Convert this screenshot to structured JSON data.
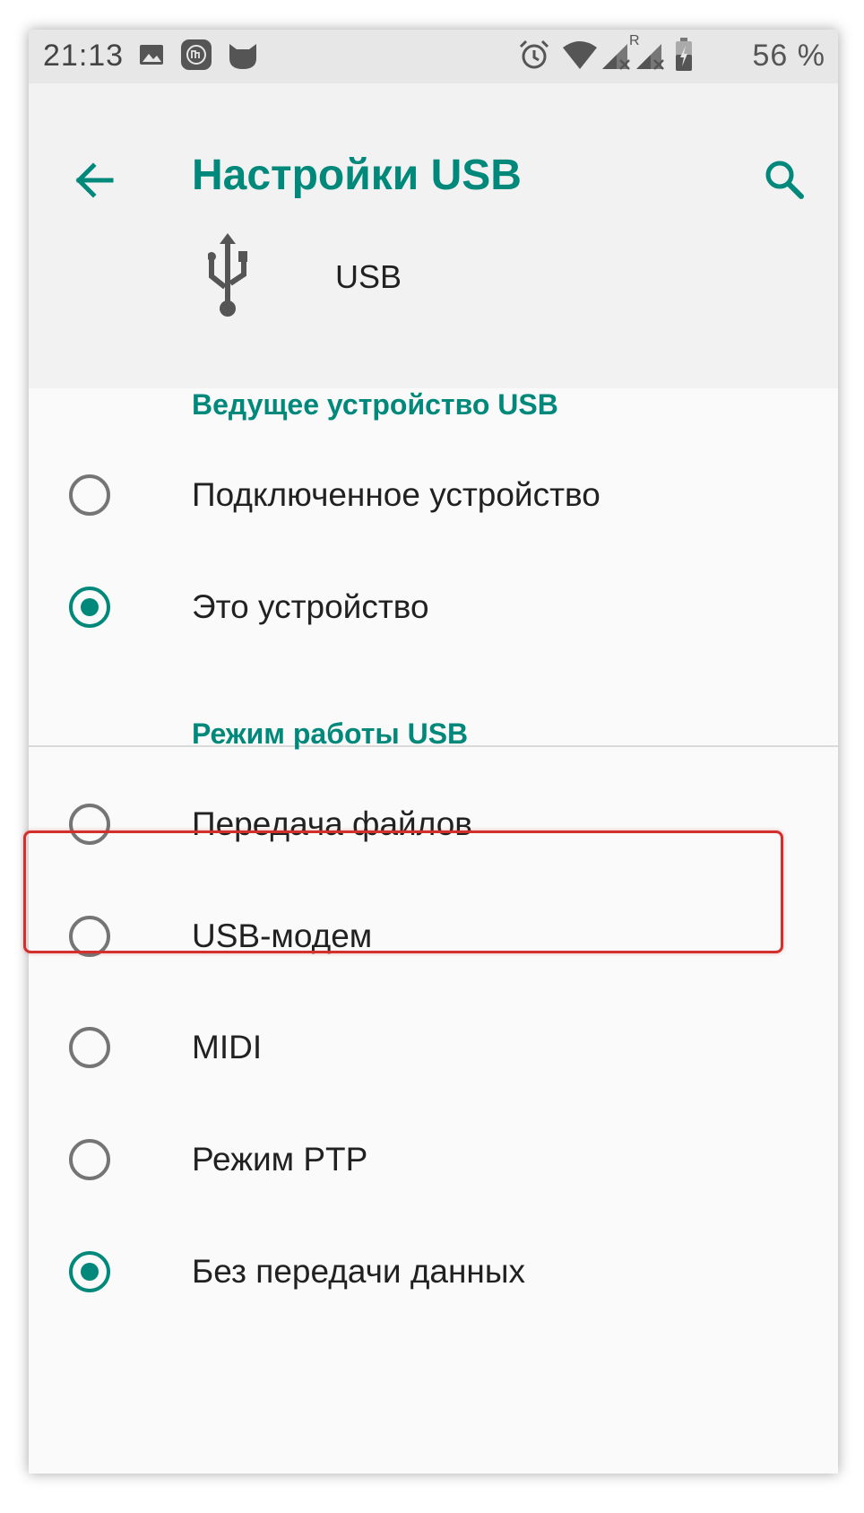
{
  "status_bar": {
    "time": "21:13",
    "battery_text": "56 %",
    "signal_r_label": "R",
    "icons": [
      "image-icon",
      "mi-icon",
      "cat-icon",
      "alarm-icon",
      "wifi-icon",
      "signal-icon",
      "signal-roaming-icon",
      "battery-icon"
    ]
  },
  "app_bar": {
    "title": "Настройки USB",
    "back_icon": "arrow-left-icon",
    "search_icon": "search-icon"
  },
  "device": {
    "icon": "usb-icon",
    "label": "USB"
  },
  "host_section": {
    "title": "Ведущее устройство USB",
    "options": [
      {
        "label": "Подключенное устройство",
        "selected": false
      },
      {
        "label": "Это устройство",
        "selected": true
      }
    ]
  },
  "mode_section": {
    "title": "Режим работы USB",
    "options": [
      {
        "label": "Передача файлов",
        "selected": false,
        "highlighted": true
      },
      {
        "label": "USB-модем",
        "selected": false
      },
      {
        "label": "MIDI",
        "selected": false
      },
      {
        "label": "Режим PTP",
        "selected": false
      },
      {
        "label": "Без передачи данных",
        "selected": true
      }
    ]
  },
  "colors": {
    "accent": "#00897b",
    "highlight_border": "#d32f2f",
    "status_bar_bg": "#e7e7e7",
    "header_bg": "#f2f2f2",
    "page_bg": "#fafafa"
  }
}
